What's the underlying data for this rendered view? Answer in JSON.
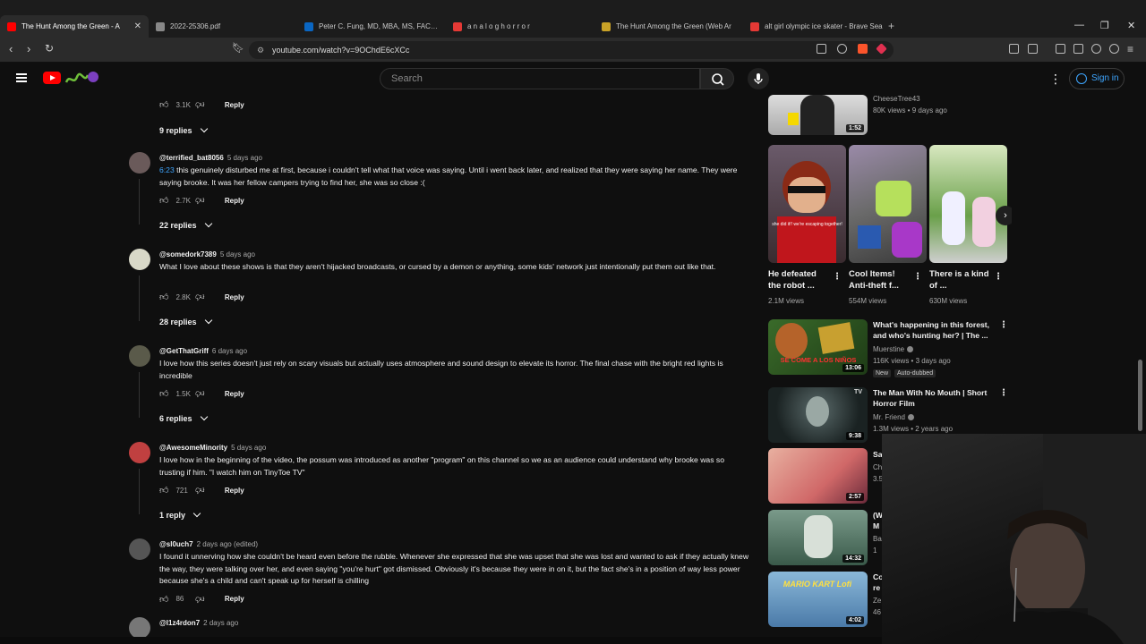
{
  "browser": {
    "tabs": [
      {
        "title": "The Hunt Among the Green - A",
        "active": true,
        "favicon_color": "#ff0000"
      },
      {
        "title": "2022-25306.pdf",
        "active": false,
        "favicon_color": "#888888"
      },
      {
        "title": "Peter C. Fung, MD, MBA, MS, FACP, F",
        "active": false,
        "favicon_color": "#0a66c2"
      },
      {
        "title": "a n a l o g h o r r o r",
        "active": false,
        "favicon_color": "#e53935"
      },
      {
        "title": "The Hunt Among the Green (Web Ar",
        "active": false,
        "favicon_color": "#c9a227"
      },
      {
        "title": "alt girl olympic ice skater - Brave Sea",
        "active": false,
        "favicon_color": "#e53935"
      }
    ],
    "url": "youtube.com/watch?v=9OChdE6cXCc"
  },
  "header": {
    "search_placeholder": "Search",
    "sign_in": "Sign in"
  },
  "comments": {
    "top_actions": {
      "likes": "3.1K",
      "reply": "Reply"
    },
    "top_replies": "9 replies",
    "items": [
      {
        "author": "@terrified_bat8056",
        "time": "5 days ago",
        "timestamp_link": "6:23",
        "text": " this genuinely disturbed me at first, because i couldn't tell what that voice was saying. Until i went back later, and realized that they were saying her name. They were saying brooke. It was her fellow campers trying to find her, she was so close :(",
        "likes": "2.7K",
        "reply": "Reply",
        "replies": "22 replies"
      },
      {
        "author": "@somedork7389",
        "time": "5 days ago",
        "timestamp_link": "",
        "text": "What I love about these shows is that they aren't hijacked broadcasts, or cursed by a demon or anything, some kids' network just intentionally put them out like that.",
        "likes": "2.8K",
        "reply": "Reply",
        "replies": "28 replies"
      },
      {
        "author": "@GetThatGriff",
        "time": "6 days ago",
        "timestamp_link": "",
        "text": "I love how this series doesn't just  rely on scary visuals but actually uses atmosphere and sound design to elevate its horror. The final chase with the bright red lights is incredible",
        "likes": "1.5K",
        "reply": "Reply",
        "replies": "6 replies"
      },
      {
        "author": "@AwesomeMinority",
        "time": "5 days ago",
        "timestamp_link": "",
        "text": "I love how in the beginning of the video, the possum was introduced as another \"program\" on this channel so we as an audience could understand why brooke was so trusting if him. \"I watch him on TinyToe TV\"",
        "likes": "721",
        "reply": "Reply",
        "replies": "1 reply"
      },
      {
        "author": "@sl0uch7",
        "time": "2 days ago (edited)",
        "timestamp_link": "",
        "text": "I found it unnerving how she couldn't be heard even before the rubble. Whenever she expressed that she was upset that she was lost and wanted to ask if they actually knew the way, they were talking over her, and even saying \"you're hurt\" got dismissed. Obviously it's because they were in on it, but the fact she's in a position of way less power because she's a child and can't speak up for herself is chilling",
        "likes": "86",
        "reply": "Reply",
        "replies": ""
      },
      {
        "author": "@l1z4rdon7",
        "time": "2 days ago",
        "timestamp_link": "",
        "text": "",
        "likes": "",
        "reply": "",
        "replies": ""
      }
    ]
  },
  "sidebar": {
    "top_item": {
      "channel": "CheeseTree43",
      "meta": "80K views • 9 days ago",
      "duration": "1:52"
    },
    "shorts": [
      {
        "title": "He defeated the robot ...",
        "views": "2.1M views",
        "thumb_caption": "she did it!! we're escaping together!"
      },
      {
        "title": "Cool Items! Anti-theft f...",
        "views": "554M views",
        "thumb_caption": ""
      },
      {
        "title": "There is a kind of ...",
        "views": "630M views",
        "thumb_caption": ""
      }
    ],
    "videos": [
      {
        "title": "What's happening in this forest, and who's hunting her? | The ...",
        "channel": "Muerstine",
        "meta": "116K views • 3 days ago",
        "badges": [
          "New",
          "Auto-dubbed"
        ],
        "duration": "13:06",
        "thumb_text": "SE COME A LOS NIÑOS"
      },
      {
        "title": "The Man With No Mouth | Short Horror Film",
        "channel": "Mr. Friend",
        "meta": "1.3M views • 2 years ago",
        "badges": [],
        "duration": "9:38",
        "thumb_text": "TV"
      },
      {
        "title": "Sa",
        "channel": "Ch",
        "meta": "3.5",
        "badges": [],
        "duration": "2:57",
        "thumb_text": ""
      },
      {
        "title": "(W M",
        "channel": "Ba",
        "meta": "1",
        "badges": [],
        "duration": "14:32",
        "thumb_text": ""
      },
      {
        "title": "Co re",
        "channel": "Ze",
        "meta": "46",
        "badges": [],
        "duration": "4:02",
        "thumb_text": "MARIO KART Lofi"
      }
    ]
  }
}
